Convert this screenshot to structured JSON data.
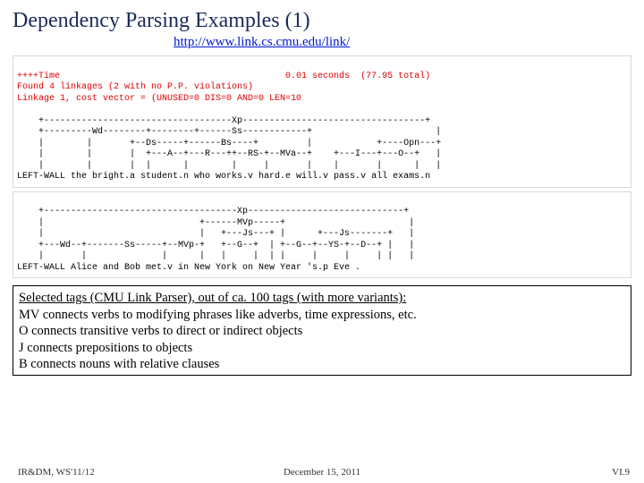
{
  "title": "Dependency Parsing Examples (1)",
  "url": "http://www.link.cs.cmu.edu/link/",
  "parse1_header": "++++Time                                          0.01 seconds  (77.95 total)\nFound 4 linkages (2 with no P.P. violations)\nLinkage 1, cost vector = (UNUSED=0 DIS=0 AND=0 LEN=10",
  "parse1_diagram": "    +-----------------------------------Xp----------------------------------+\n    +---------Wd--------+--------+------Ss------------+                       |\n    |        |       +--Ds-----+------Bs----+         |            +----Opn---+\n    |        |       |  +---A--+---R---++--RS-+--MVa--+    +---I---+---O--+   |\n    |        |       |  |      |        |     |       |    |       |      |   |\nLEFT-WALL the bright.a student.n who works.v hard.e will.v pass.v all exams.n",
  "parse2_diagram": "    +------------------------------------Xp-----------------------------+\n    |                             +------MVp-----+                       |\n    |                             |   +---Js---+ |      +---Js-------+   |\n    +---Wd--+-------Ss-----+--MVp-+   +--G--+  | +--G--+--YS-+--D--+ |   |\n    |       |              |      |   |     |  | |     |     |     | |   |\nLEFT-WALL Alice and Bob met.v in New York on New Year 's.p Eve .",
  "tags": {
    "heading": "Selected tags (CMU Link Parser), out of ca. 100 tags (with more variants):",
    "mv": "MV connects verbs to modifying phrases like adverbs, time expressions, etc.",
    "o": "O connects transitive verbs to direct or indirect objects",
    "j": "J connects prepositions to objects",
    "b": "B connects nouns with relative clauses"
  },
  "footer": {
    "left": "IR&DM, WS'11/12",
    "center": "December 15, 2011",
    "right": "VI.9"
  }
}
